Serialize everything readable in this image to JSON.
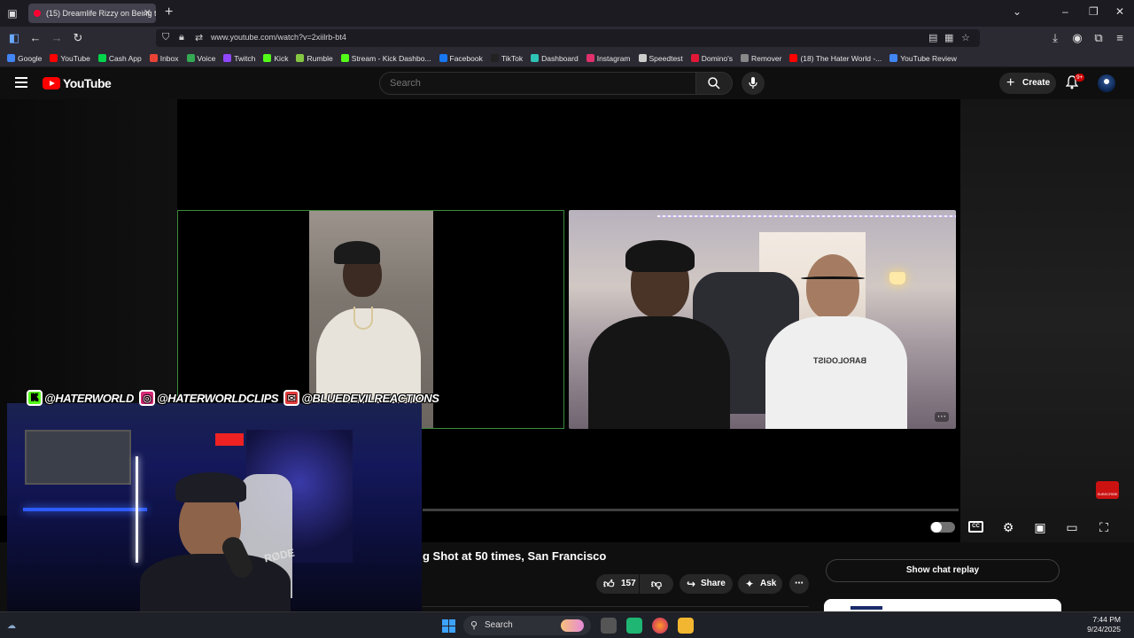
{
  "browser": {
    "tab_title": "(15) Dreamlife Rizzy on Being tl",
    "url": "www.youtube.com/watch?v=2xiilrb-bt4",
    "bookmarks": [
      {
        "label": "Google",
        "color": "#4285f4"
      },
      {
        "label": "YouTube",
        "color": "#ff0000"
      },
      {
        "label": "Cash App",
        "color": "#00d54b"
      },
      {
        "label": "Inbox",
        "color": "#ea4335"
      },
      {
        "label": "Voice",
        "color": "#34a853"
      },
      {
        "label": "Twitch",
        "color": "#9146ff"
      },
      {
        "label": "Kick",
        "color": "#53fc18"
      },
      {
        "label": "Rumble",
        "color": "#85c742"
      },
      {
        "label": "Stream - Kick Dashbo...",
        "color": "#53fc18"
      },
      {
        "label": "Facebook",
        "color": "#1877f2"
      },
      {
        "label": "TikTok",
        "color": "#222222"
      },
      {
        "label": "Dashboard",
        "color": "#2ec4b6"
      },
      {
        "label": "Instagram",
        "color": "#e1306c"
      },
      {
        "label": "Speedtest",
        "color": "#cccccc"
      },
      {
        "label": "Domino's",
        "color": "#e31837"
      },
      {
        "label": "Remover",
        "color": "#888888"
      },
      {
        "label": "(18) The Hater World -...",
        "color": "#ff0000"
      },
      {
        "label": "YouTube Review",
        "color": "#4285f4"
      }
    ]
  },
  "youtube": {
    "logo_text": "YouTube",
    "search_placeholder": "Search",
    "create_label": "Create",
    "notif_badge": "9+",
    "video_title_partial": "g Shot at 50 times, San Francisco",
    "like_count": "157",
    "share_label": "Share",
    "ask_label": "Ask",
    "chat_replay_label": "Show chat replay",
    "watermark_text": "SUBSCRIBE"
  },
  "overlay": {
    "kick_handle": "@HATERWORLD",
    "instagram_handle": "@HATERWORLDCLIPS",
    "email_handle": "@BLUEDEVILREACTIONS",
    "mic_brand": "RØDE"
  },
  "taskbar": {
    "search_label": "Search",
    "time": "7:44 PM",
    "date": "9/24/2025"
  }
}
